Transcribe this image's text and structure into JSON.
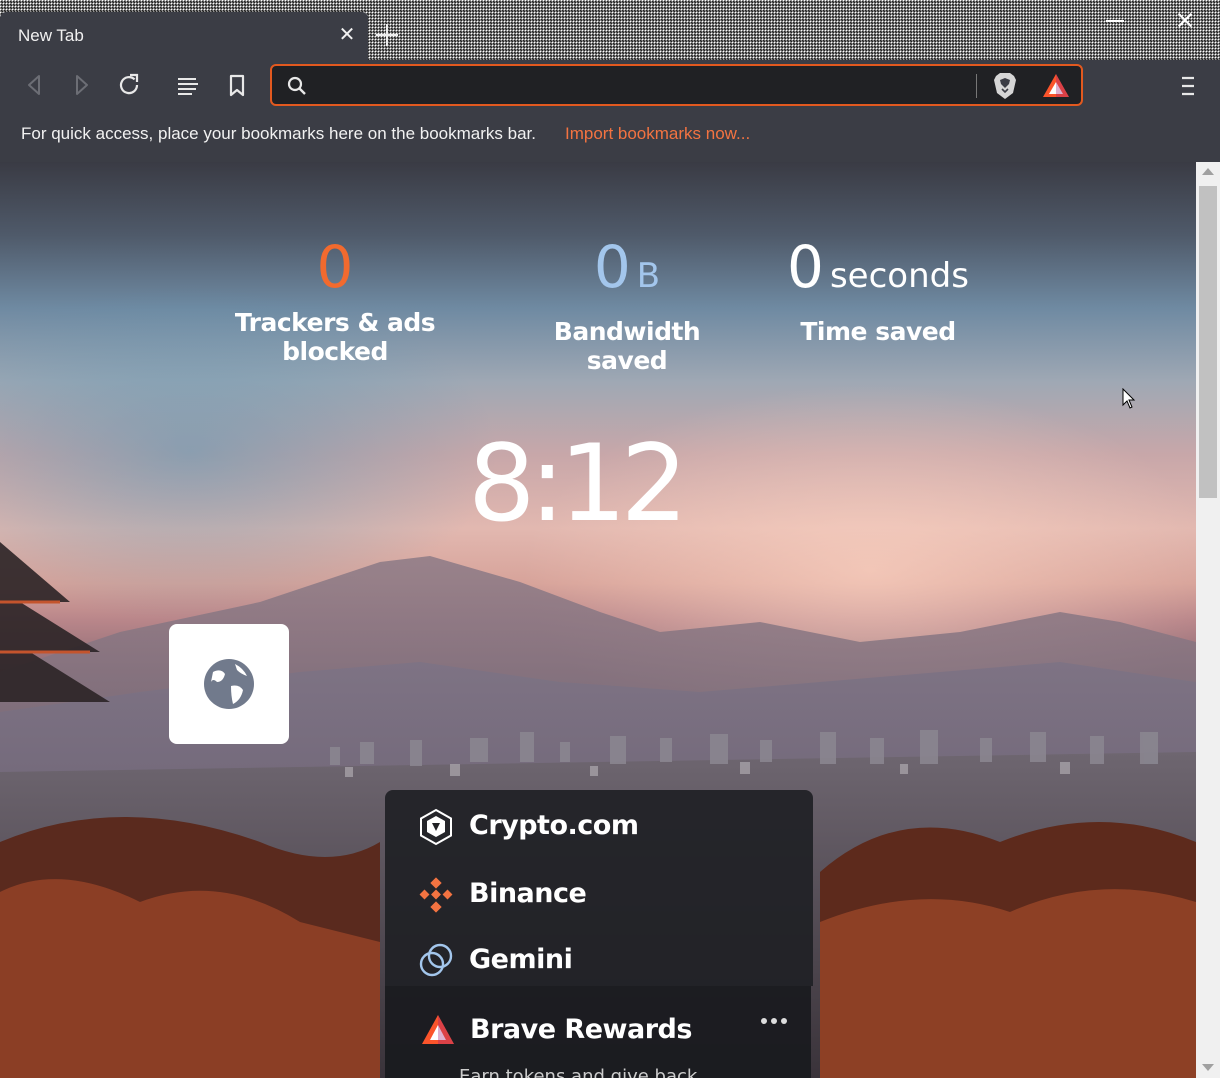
{
  "tab": {
    "title": "New Tab",
    "close": "✕"
  },
  "toolbar": {
    "search_placeholder": ""
  },
  "bookmarks_bar": {
    "message": "For quick access, place your bookmarks here on the bookmarks bar.",
    "import_link": "Import bookmarks now..."
  },
  "stats": {
    "trackers": {
      "value": "0",
      "label": "Trackers & ads blocked",
      "color": "#f26a2e"
    },
    "bandwidth": {
      "value": "0",
      "unit": "B",
      "label": "Bandwidth saved",
      "color": "#a3c6ec"
    },
    "time": {
      "value": "0",
      "unit": "seconds",
      "label": "Time saved",
      "color": "#ffffff"
    }
  },
  "clock": "8:12",
  "widgets": {
    "crypto": [
      {
        "label": "Crypto.com",
        "icon": "crypto-com-icon"
      },
      {
        "label": "Binance",
        "icon": "binance-icon"
      },
      {
        "label": "Gemini",
        "icon": "gemini-icon"
      }
    ],
    "rewards": {
      "title": "Brave Rewards",
      "subtitle": "Earn tokens and give back"
    }
  },
  "colors": {
    "accent": "#f37341",
    "brave_orange": "#e2591f",
    "toolbar": "#3b3d45"
  }
}
